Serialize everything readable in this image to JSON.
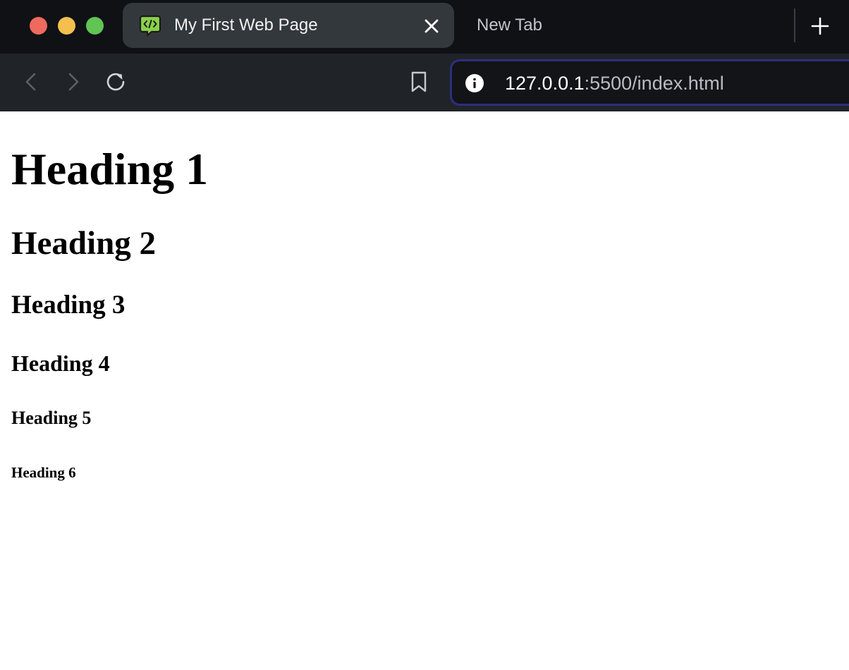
{
  "browser": {
    "tabs": [
      {
        "title": "My First Web Page",
        "active": true,
        "favicon": "code-chat-icon"
      },
      {
        "title": "New Tab",
        "active": false
      }
    ],
    "address_bar": {
      "url_host": "127.0.0.1",
      "url_rest": ":5500/index.html"
    }
  },
  "page": {
    "headings": {
      "h1": "Heading 1",
      "h2": "Heading 2",
      "h3": "Heading 3",
      "h4": "Heading 4",
      "h5": "Heading 5",
      "h6": "Heading 6"
    }
  },
  "colors": {
    "tabstrip_bg": "#0f1115",
    "active_tab_bg": "#33383d",
    "toolbar_bg": "#202428",
    "address_border": "#2e2e7e",
    "favicon_green": "#8bd04a"
  }
}
